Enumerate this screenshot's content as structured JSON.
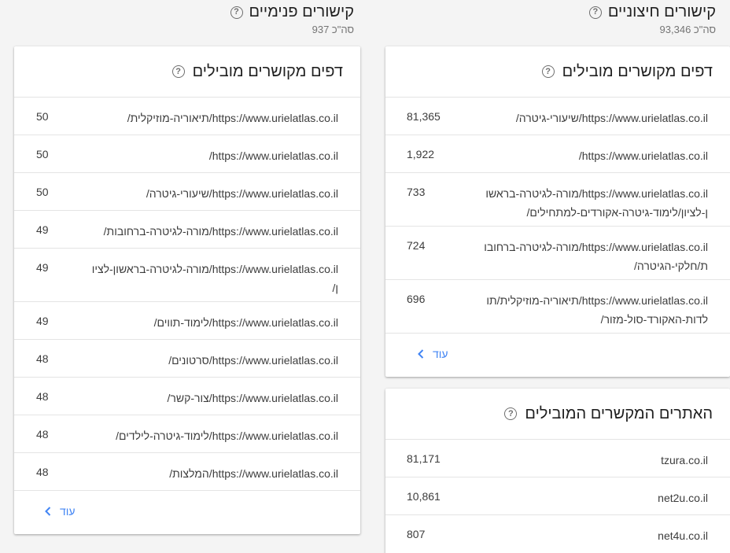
{
  "external": {
    "title": "קישורים חיצוניים",
    "total": "סה\"כ 93,346",
    "top_pages": {
      "title": "דפים מקושרים מובילים",
      "rows": [
        {
          "url": "https://www.urielatlas.co.il/שיעורי-גיטרה/",
          "value": "81,365"
        },
        {
          "url": "https://www.urielatlas.co.il/",
          "value": "1,922"
        },
        {
          "url": "https://www.urielatlas.co.il/מורה-לגיטרה-בראשון-לציון/לימוד-גיטרה-אקורדים-למתחילים/",
          "value": "733"
        },
        {
          "url": "https://www.urielatlas.co.il/מורה-לגיטרה-ברחובות/חלקי-הגיטרה/",
          "value": "724"
        },
        {
          "url": "https://www.urielatlas.co.il/תיאוריה-מוזיקלית/תולדות-האקורד-סול-מזור/",
          "value": "696"
        }
      ],
      "more_label": "עוד"
    },
    "top_sites": {
      "title": "האתרים המקשרים המובילים",
      "rows": [
        {
          "url": "tzura.co.il",
          "value": "81,171"
        },
        {
          "url": "net2u.co.il",
          "value": "10,861"
        },
        {
          "url": "net4u.co.il",
          "value": "807"
        }
      ]
    }
  },
  "internal": {
    "title": "קישורים פנימיים",
    "total": "סה\"כ 937",
    "top_pages": {
      "title": "דפים מקושרים מובילים",
      "rows": [
        {
          "url": "https://www.urielatlas.co.il/תיאוריה-מוזיקלית/",
          "value": "50"
        },
        {
          "url": "https://www.urielatlas.co.il/",
          "value": "50"
        },
        {
          "url": "https://www.urielatlas.co.il/שיעורי-גיטרה/",
          "value": "50"
        },
        {
          "url": "https://www.urielatlas.co.il/מורה-לגיטרה-ברחובות/",
          "value": "49"
        },
        {
          "url": "https://www.urielatlas.co.il/מורה-לגיטרה-בראשון-לציון/",
          "value": "49"
        },
        {
          "url": "https://www.urielatlas.co.il/לימוד-תווים/",
          "value": "49"
        },
        {
          "url": "https://www.urielatlas.co.il/סרטונים/",
          "value": "48"
        },
        {
          "url": "https://www.urielatlas.co.il/צור-קשר/",
          "value": "48"
        },
        {
          "url": "https://www.urielatlas.co.il/לימוד-גיטרה-לילדים/",
          "value": "48"
        },
        {
          "url": "https://www.urielatlas.co.il/המלצות/",
          "value": "48"
        }
      ],
      "more_label": "עוד"
    }
  },
  "icons": {
    "help": "help-circle-icon",
    "more": "chevron-left-icon"
  },
  "colors": {
    "accent": "#4285f4",
    "text": "#212121",
    "muted": "#757575",
    "divider": "#e4e4e4"
  }
}
